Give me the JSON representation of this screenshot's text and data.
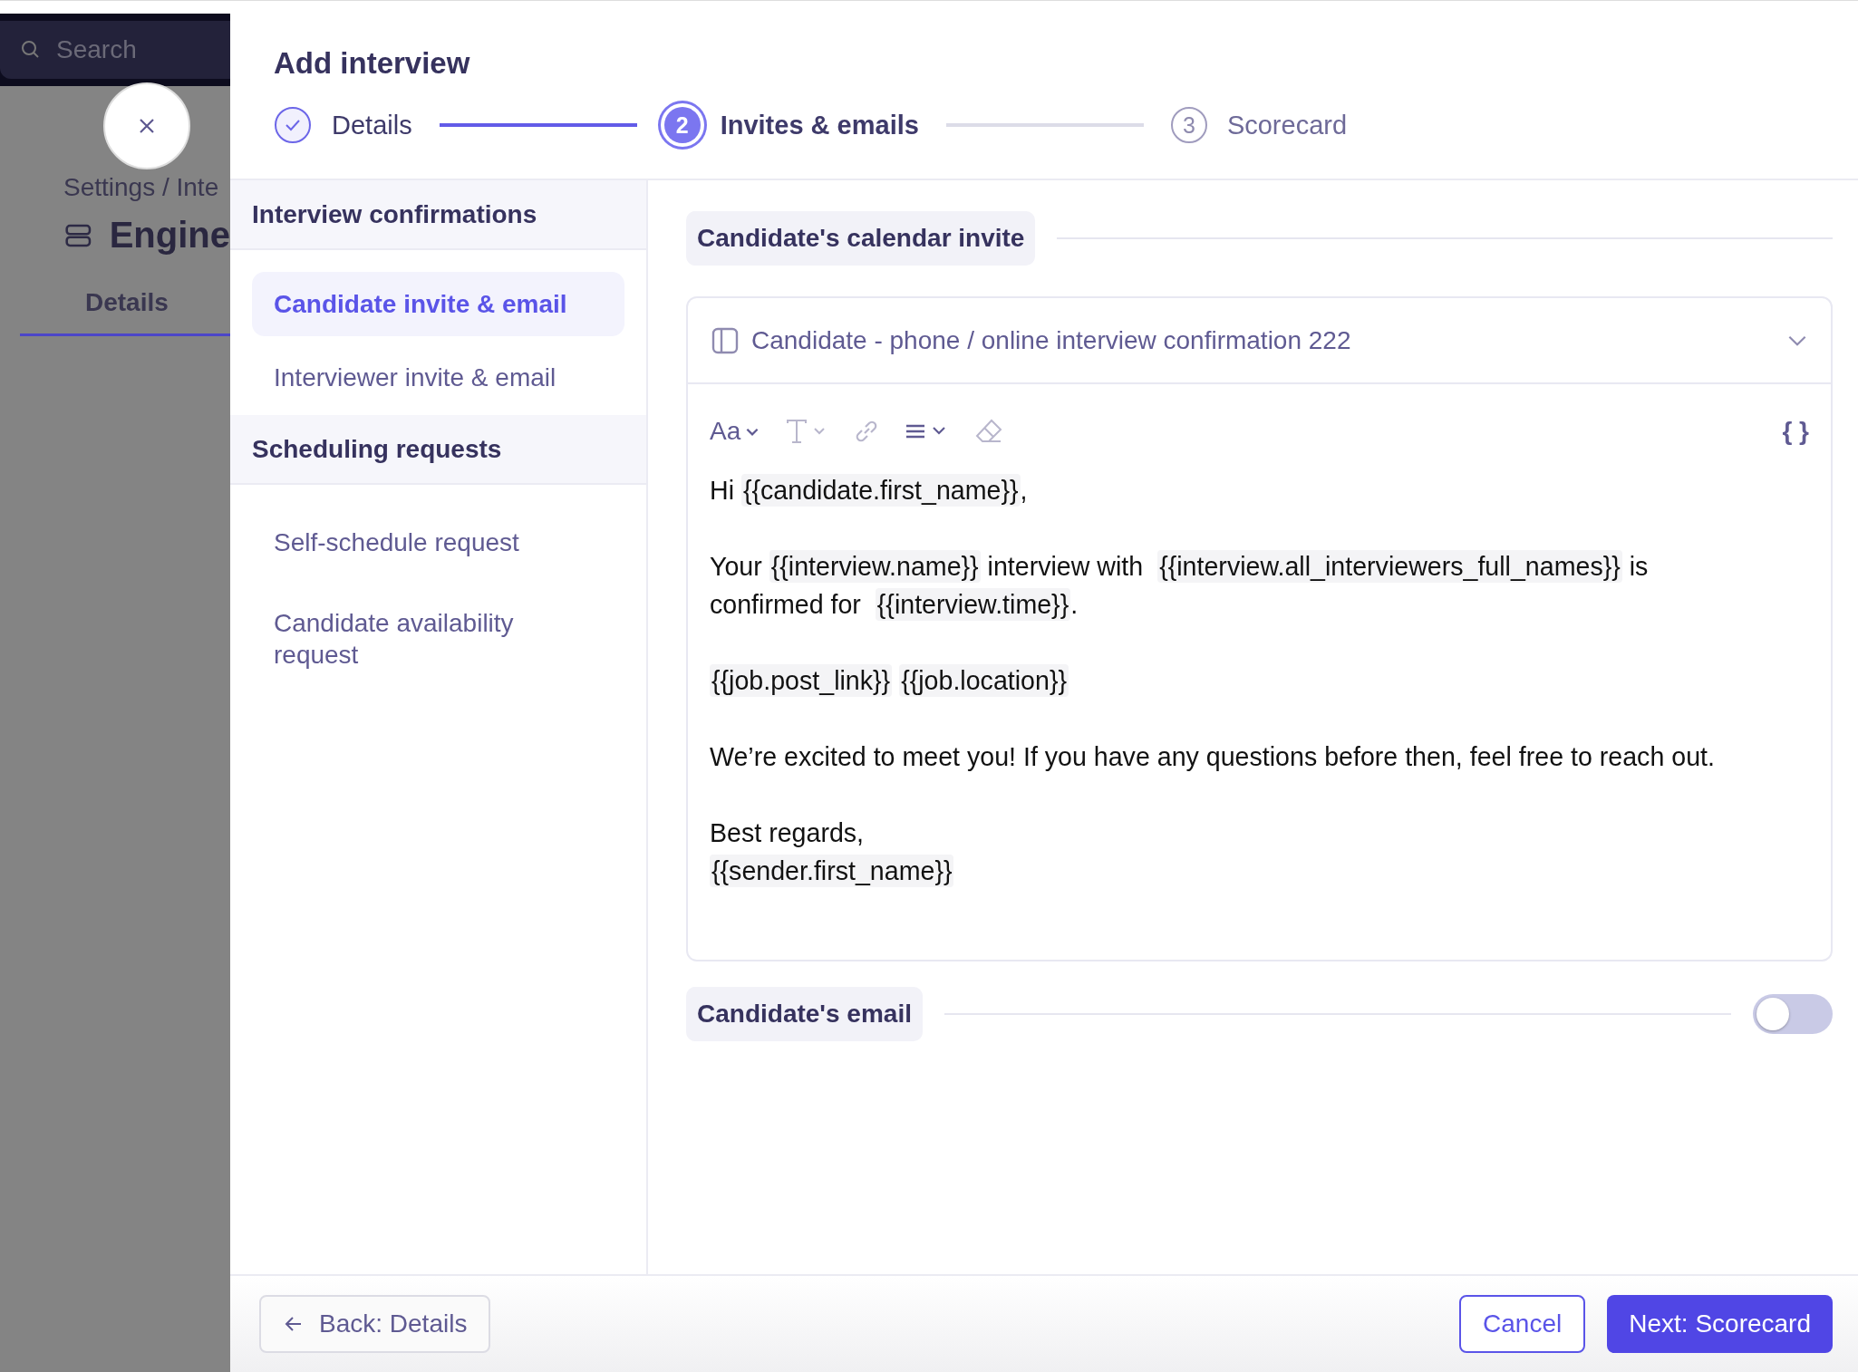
{
  "background_page": {
    "search": {
      "placeholder": "Search"
    },
    "breadcrumb": "Settings / Inte",
    "title": "Engine",
    "tabs": [
      {
        "label": "Details",
        "selected": true
      }
    ]
  },
  "modal": {
    "title": "Add interview",
    "steps": [
      {
        "label": "Details",
        "complete": true,
        "selected": false
      },
      {
        "number": "2",
        "label": "Invites & emails",
        "complete": false,
        "selected": true
      },
      {
        "number": "3",
        "label": "Scorecard",
        "complete": false,
        "selected": false
      }
    ],
    "sidebar": [
      {
        "heading": "Interview confirmations",
        "items": [
          {
            "label": "Candidate invite & email",
            "selected": true
          },
          {
            "label": "Interviewer invite & email",
            "selected": false
          }
        ]
      },
      {
        "heading": "Scheduling requests",
        "items": [
          {
            "label": "Self-schedule request",
            "selected": false
          },
          {
            "label": "Candidate availability request",
            "selected": false
          }
        ]
      }
    ],
    "calendar_invite": {
      "heading": "Candidate's calendar invite",
      "template": "Candidate - phone / online interview confirmation 222",
      "toolbar": [
        {
          "kind": "font",
          "text": "Aa",
          "disabled": false
        },
        {
          "kind": "text-style",
          "disabled": true
        },
        {
          "kind": "link",
          "disabled": true
        },
        {
          "kind": "align",
          "disabled": false
        },
        {
          "kind": "eraser",
          "disabled": true
        }
      ],
      "variables_button": "{ }",
      "body": [
        [
          [
            {
              "kind": "text",
              "text": "Hi "
            },
            {
              "kind": "variable",
              "text": "{{candidate.first_name}}"
            },
            {
              "kind": "text",
              "text": ","
            }
          ]
        ],
        [
          [
            {
              "kind": "text",
              "text": "Your "
            },
            {
              "kind": "variable",
              "text": "{{interview.name}}"
            },
            {
              "kind": "text",
              "text": " interview with "
            },
            {
              "kind": "variable",
              "text": "{{interview.all_interviewers_full_names}}"
            },
            {
              "kind": "text",
              "text": " is confirmed for "
            },
            {
              "kind": "variable",
              "text": "{{interview.time}}"
            },
            {
              "kind": "text",
              "text": "."
            }
          ]
        ],
        [
          [
            {
              "kind": "variable",
              "text": "{{job.post_link}}"
            },
            {
              "kind": "variable",
              "text": "{{job.location}}"
            }
          ]
        ],
        [
          [
            {
              "kind": "text",
              "text": "We’re excited to meet you! If you have any questions before then, feel free to reach out."
            }
          ]
        ],
        [
          [
            {
              "kind": "text",
              "text": "Best regards,"
            }
          ],
          [
            {
              "kind": "variable",
              "text": "{{sender.first_name}}"
            }
          ]
        ]
      ]
    },
    "candidate_email": {
      "heading": "Candidate's email",
      "on": false
    },
    "footer": {
      "back": "Back: Details",
      "cancel": "Cancel",
      "next": "Next: Scorecard"
    }
  }
}
